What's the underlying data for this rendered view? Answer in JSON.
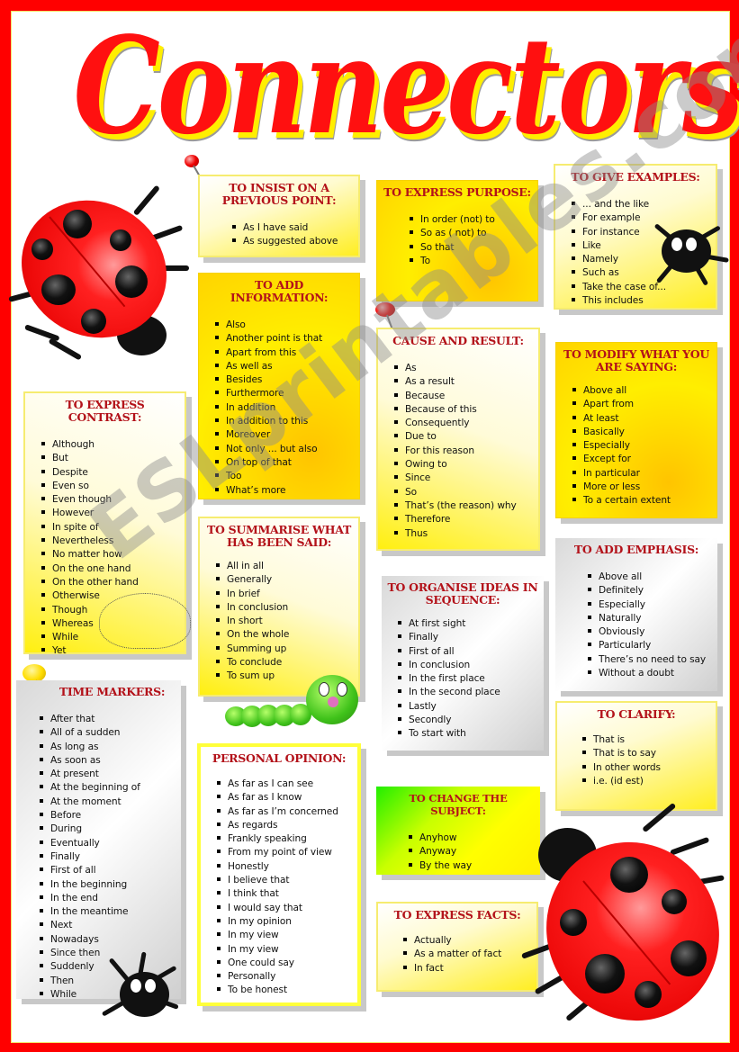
{
  "title": "Connectors",
  "watermark": "ESLprintables.com",
  "sections": {
    "insist": {
      "heading": "TO INSIST ON A PREVIOUS POINT:",
      "items": [
        "As I have said",
        "As suggested above"
      ]
    },
    "add_information": {
      "heading": "TO ADD INFORMATION:",
      "items": [
        "Also",
        "Another point is that",
        "Apart from this",
        "As well as",
        "Besides",
        "Furthermore",
        "In addition",
        "In addition to this",
        "Moreover",
        "Not only ... but also",
        "On top of that",
        "Too",
        "What’s more"
      ]
    },
    "purpose": {
      "heading": "TO EXPRESS PURPOSE:",
      "items": [
        "In order (not)  to",
        "So as ( not) to",
        "So that",
        "To"
      ]
    },
    "examples": {
      "heading": "TO GIVE EXAMPLES:",
      "items": [
        "... and the like",
        "For example",
        "For instance",
        "Like",
        "Namely",
        "Such as",
        "Take the case of...",
        "This includes"
      ]
    },
    "cause_result": {
      "heading": "CAUSE AND RESULT:",
      "items": [
        "As",
        "As a result",
        "Because",
        "Because of this",
        "Consequently",
        "Due to",
        "For this reason",
        "Owing to",
        "Since",
        "So",
        "That’s (the reason) why",
        "Therefore",
        "Thus"
      ]
    },
    "modify": {
      "heading": "TO MODIFY WHAT YOU ARE SAYING:",
      "items": [
        "Above all",
        "Apart from",
        "At least",
        "Basically",
        "Especially",
        "Except for",
        "In particular",
        "More or less",
        "To a certain extent"
      ]
    },
    "contrast": {
      "heading": "TO EXPRESS CONTRAST:",
      "items": [
        "Although",
        "But",
        "Despite",
        "Even so",
        "Even though",
        "However",
        "In spite of",
        "Nevertheless",
        "No matter how",
        "On the one hand",
        "On the other hand",
        "Otherwise",
        "Though",
        "Whereas",
        "While",
        "Yet"
      ]
    },
    "summarise": {
      "heading": "TO SUMMARISE WHAT HAS BEEN SAID:",
      "items": [
        "All in all",
        "Generally",
        "In brief",
        "In conclusion",
        "In short",
        "On the whole",
        "Summing up",
        "To conclude",
        "To sum up"
      ]
    },
    "sequence": {
      "heading": "TO ORGANISE IDEAS IN SEQUENCE:",
      "items": [
        "At first sight",
        "Finally",
        "First of all",
        "In conclusion",
        "In the first place",
        "In the second place",
        "Lastly",
        "Secondly",
        "To start with"
      ]
    },
    "emphasis": {
      "heading": "TO ADD EMPHASIS:",
      "items": [
        "Above all",
        "Definitely",
        "Especially",
        "Naturally",
        "Obviously",
        "Particularly",
        "There’s no need to say",
        "Without a doubt"
      ]
    },
    "time": {
      "heading": "TIME MARKERS:",
      "items": [
        "After that",
        "All of a sudden",
        "As long as",
        "As soon as",
        "At present",
        "At the beginning of",
        "At the moment",
        "Before",
        "During",
        "Eventually",
        "Finally",
        "First of all",
        "In the beginning",
        "In the end",
        "In the meantime",
        "Next",
        "Nowadays",
        "Since then",
        "Suddenly",
        "Then",
        "While"
      ]
    },
    "opinion": {
      "heading": "PERSONAL OPINION:",
      "items": [
        "As far as I can see",
        "As far as I know",
        "As far as I’m concerned",
        "As regards",
        "Frankly speaking",
        "From my point of view",
        "Honestly",
        "I believe that",
        "I think that",
        "I would say that",
        "In my opinion",
        "In my view",
        "In my view",
        "One could say",
        "Personally",
        "To be honest"
      ]
    },
    "clarify": {
      "heading": "TO CLARIFY:",
      "items": [
        "That is",
        "That is to say",
        "In other words",
        "i.e. (id est)"
      ]
    },
    "change_subject": {
      "heading": "TO CHANGE THE SUBJECT:",
      "items": [
        "Anyhow",
        "Anyway",
        "By the way"
      ]
    },
    "facts": {
      "heading": "TO EXPRESS FACTS:",
      "items": [
        "Actually",
        "As a matter of fact",
        "In fact"
      ]
    }
  },
  "colors": {
    "frame": "#ff0000",
    "title": "#ff1010",
    "title_shadow": "#ffee00",
    "heading": "#b3121a"
  }
}
